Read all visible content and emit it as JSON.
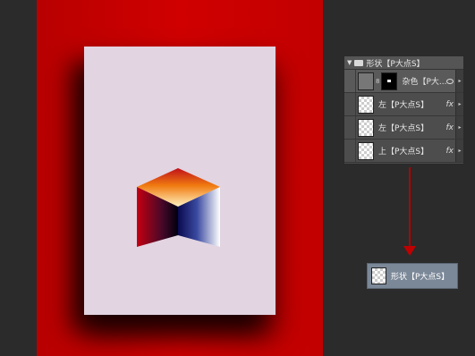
{
  "canvas": {
    "artboard_color": "#c80000",
    "paper_color": "#e2d4e1"
  },
  "layers_panel": {
    "group_name": "形状【P大点S】",
    "layers": [
      {
        "name": "杂色【P大...",
        "type": "fill-with-mask"
      },
      {
        "name": "左【P大点S】",
        "type": "shape",
        "fx": "fx"
      },
      {
        "name": "左【P大点S】",
        "type": "shape",
        "fx": "fx"
      },
      {
        "name": "上【P大点S】",
        "type": "shape",
        "fx": "fx"
      }
    ]
  },
  "annotation": {
    "arrow_color": "#c00000"
  },
  "merged_layer": {
    "name": "形状【P大点S】"
  }
}
